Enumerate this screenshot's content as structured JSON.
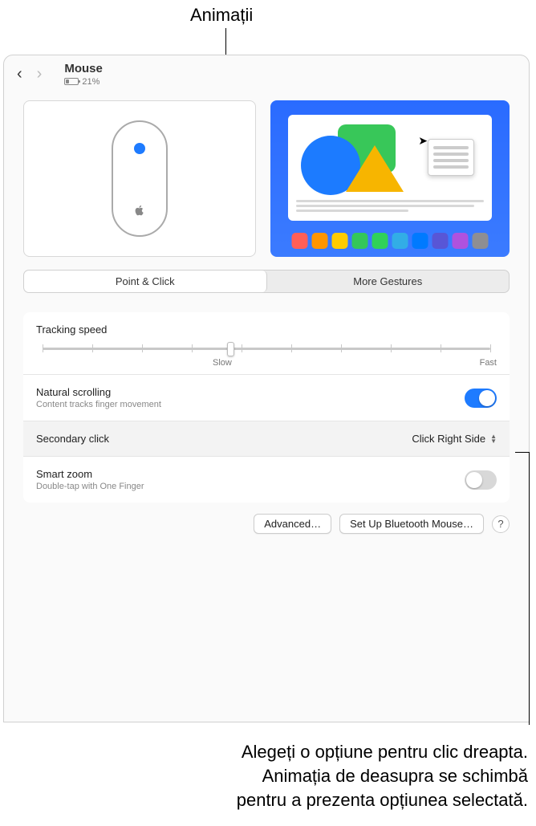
{
  "callouts": {
    "top": "Animații",
    "bottom_line1": "Alegeți o opțiune pentru clic dreapta.",
    "bottom_line2": "Animația de deasupra se schimbă",
    "bottom_line3": "pentru a prezenta opțiunea selectată."
  },
  "header": {
    "title": "Mouse",
    "battery_percent": "21%",
    "battery_fill_pct": 21
  },
  "tabs": {
    "point_click": "Point & Click",
    "more_gestures": "More Gestures"
  },
  "settings": {
    "tracking": {
      "label": "Tracking speed",
      "slow": "Slow",
      "fast": "Fast",
      "position_pct": 42
    },
    "natural": {
      "label": "Natural scrolling",
      "sub": "Content tracks finger movement",
      "on": true
    },
    "secondary": {
      "label": "Secondary click",
      "value": "Click Right Side"
    },
    "smartzoom": {
      "label": "Smart zoom",
      "sub": "Double-tap with One Finger",
      "on": false
    }
  },
  "buttons": {
    "advanced": "Advanced…",
    "bluetooth": "Set Up Bluetooth Mouse…",
    "help": "?"
  },
  "dock_colors": [
    "#ff5f57",
    "#ff9500",
    "#ffcc00",
    "#34c759",
    "#30d158",
    "#32ade6",
    "#007aff",
    "#5856d6",
    "#af52de",
    "#8e8e93"
  ]
}
